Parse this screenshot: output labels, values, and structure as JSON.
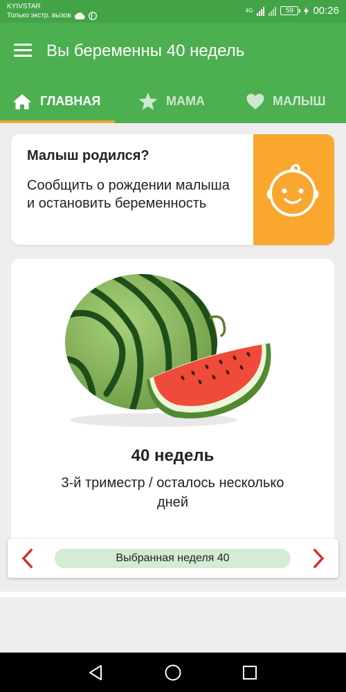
{
  "status_bar": {
    "carrier": "KYIVSTAR",
    "carrier_note": "Только экстр. вызов",
    "network": "4G",
    "battery": "59",
    "time": "00:26",
    "icons": [
      "cloud-icon",
      "pinterest-icon",
      "signal-icon",
      "no-sim-signal-icon",
      "battery-icon",
      "charging-icon"
    ]
  },
  "app_bar": {
    "title": "Вы беременны 40 недель",
    "menu_icon": "menu-icon"
  },
  "tabs": [
    {
      "label": "ГЛАВНАЯ",
      "icon": "home-icon",
      "active": true
    },
    {
      "label": "МАМА",
      "icon": "star-icon",
      "active": false
    },
    {
      "label": "МАЛЫШ",
      "icon": "heart-icon",
      "active": false
    }
  ],
  "baby_card": {
    "title": "Малыш родился?",
    "text": "Сообщить о рождении малыша и остановить беременность",
    "icon": "baby-face-icon"
  },
  "week_card": {
    "image": "watermelon-illustration",
    "title": "40 недель",
    "subtitle_line1": "3-й триместр / осталось несколько",
    "subtitle_line2": "дней"
  },
  "week_selector": {
    "label": "Выбранная неделя 40",
    "prev_icon": "chevron-left-icon",
    "next_icon": "chevron-right-icon"
  },
  "nav_bar": {
    "icons": [
      "back-icon",
      "home-circle-icon",
      "recents-icon"
    ]
  },
  "colors": {
    "status_bar": "#43a447",
    "primary": "#4caf50",
    "tab_indicator": "#f7a440",
    "baby_card_accent": "#f9a72e",
    "arrow": "#d32f2f",
    "week_pill": "#d4ebd4",
    "background": "#eeeeee"
  }
}
